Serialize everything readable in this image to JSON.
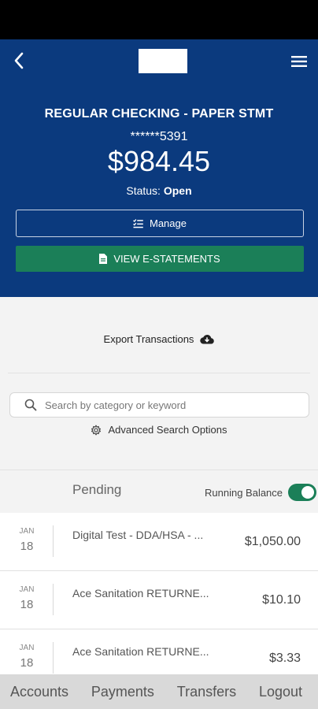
{
  "header": {
    "account_name": "REGULAR CHECKING - PAPER STMT",
    "account_number": "******5391",
    "balance": "$984.45",
    "status_label": "Status:",
    "status_value": "Open",
    "manage_label": "Manage",
    "estatements_label": "VIEW E-STATEMENTS",
    "accent_color": "#0b3a7e",
    "button_color": "#1b7f58"
  },
  "actions": {
    "export_label": "Export Transactions",
    "advanced_search_label": "Advanced Search Options"
  },
  "search": {
    "placeholder": "Search by category or keyword",
    "value": ""
  },
  "pending": {
    "label": "Pending",
    "running_balance_label": "Running Balance",
    "running_balance_on": true
  },
  "transactions": [
    {
      "month": "JAN",
      "day": "18",
      "description": "Digital Test - DDA/HSA - ...",
      "amount": "$1,050.00"
    },
    {
      "month": "JAN",
      "day": "18",
      "description": "Ace Sanitation RETURNE...",
      "amount": "$10.10"
    },
    {
      "month": "JAN",
      "day": "18",
      "description": "Ace Sanitation RETURNE...",
      "amount": "$3.33"
    }
  ],
  "nav": {
    "accounts": "Accounts",
    "payments": "Payments",
    "transfers": "Transfers",
    "logout": "Logout"
  }
}
